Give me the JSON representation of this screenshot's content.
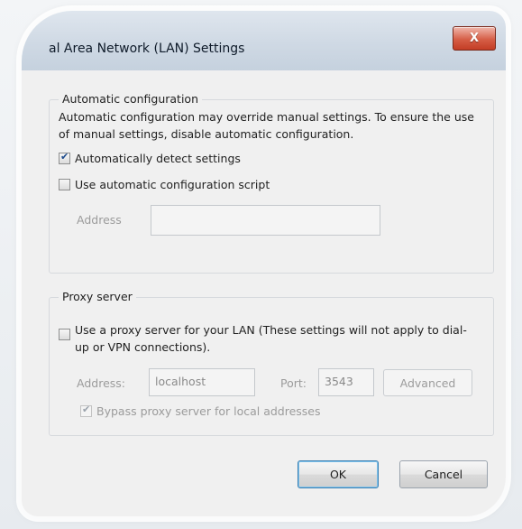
{
  "window": {
    "title": "al Area Network (LAN) Settings",
    "close_glyph": "X"
  },
  "auto_config": {
    "legend": "Automatic configuration",
    "description": "Automatic configuration may override manual settings.  To ensure the use of manual settings, disable automatic configuration.",
    "detect_label": "Automatically detect settings",
    "detect_checked": true,
    "script_label": "Use automatic configuration script",
    "script_checked": false,
    "address_label": "Address",
    "address_value": ""
  },
  "proxy": {
    "legend": "Proxy server",
    "use_proxy_label": "Use a proxy server for your LAN (These settings will not apply to dial-up or VPN connections).",
    "use_proxy_checked": false,
    "address_label": "Address:",
    "address_value": "localhost",
    "port_label": "Port:",
    "port_value": "3543",
    "advanced_label": "Advanced",
    "bypass_label": "Bypass proxy server for local addresses",
    "bypass_checked": true
  },
  "buttons": {
    "ok_label": "OK",
    "cancel_label": "Cancel"
  },
  "colors": {
    "close_button": "#c33d25",
    "default_button_border": "#3c7fb1",
    "titlebar": "#cfd9e4",
    "client_bg": "#f0f0f0"
  }
}
